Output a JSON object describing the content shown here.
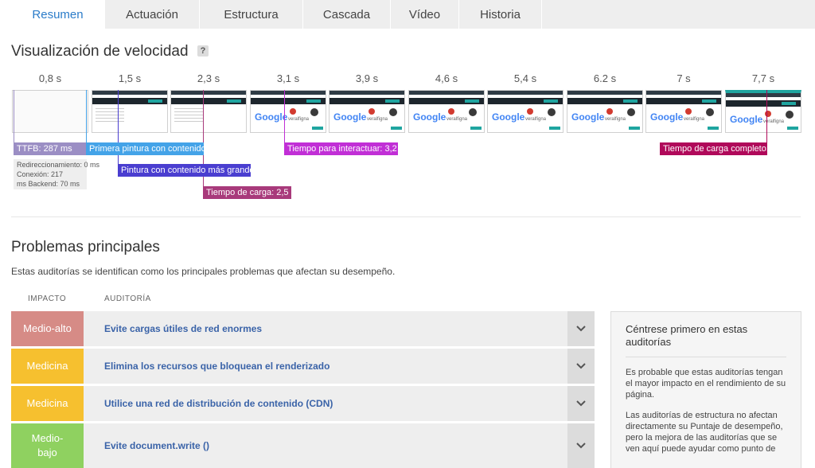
{
  "tabs": [
    "Resumen",
    "Actuación",
    "Estructura",
    "Cascada",
    "Vídeo",
    "Historia"
  ],
  "speed": {
    "title": "Visualización de velocidad",
    "help": "?",
    "times": [
      "0,8 s",
      "1,5 s",
      "2,3 s",
      "3,1 s",
      "3,9 s",
      "4,6 s",
      "5,4 s",
      "6.2 s",
      "7 s",
      "7,7 s"
    ],
    "frame_text": {
      "google": "Google",
      "web": "veralfigna",
      "sub": "Tipo de Campo"
    },
    "markers": {
      "ttfb": "TTFB: 287 ms",
      "first_paint": "Primera pintura con contenido: 1,5 s",
      "largest_paint": "Pintura con contenido más grande: 1,9 s",
      "load_time": "Tiempo de carga: 2,5 s",
      "interactive": "Tiempo para interactuar: 3,2 s",
      "fully_loaded": "Tiempo de carga completo: 7,9 s",
      "colors": {
        "ttfb": "#9b8ec4",
        "first_paint": "#44a3e8",
        "largest_paint": "#4a3ed0",
        "load_time": "#a83a7b",
        "interactive": "#c12fd6",
        "fully_loaded": "#b0095a"
      }
    },
    "ttfb_details": [
      "Redireccionamiento: 0 ms",
      "Conexión: 217",
      "ms Backend: 70 ms"
    ]
  },
  "problems": {
    "title": "Problemas principales",
    "description": "Estas auditorías se identifican como los principales problemas que afectan su desempeño.",
    "col_impact": "IMPACTO",
    "col_audit": "AUDITORÍA",
    "rows": [
      {
        "impact": "Medio-alto",
        "audit": "Evite cargas útiles de red enormes",
        "color": "#d68b86"
      },
      {
        "impact": "Medicina",
        "audit": "Elimina los recursos que bloquean el renderizado",
        "color": "#f6c02f"
      },
      {
        "impact": "Medicina",
        "audit": "Utilice una red de distribución de contenido (CDN)",
        "color": "#f6c02f"
      },
      {
        "impact": "Medio-bajo",
        "audit": "Evite document.write ()",
        "color": "#8fd160"
      }
    ]
  },
  "sidebar": {
    "title": "Céntrese primero en estas auditorías",
    "p1": "Es probable que estas auditorías tengan el mayor impacto en el rendimiento de su página.",
    "p2": "Las auditorías de estructura no afectan directamente su Puntaje de desempeño, pero la mejora de las auditorías que se ven aquí puede ayudar como punto de"
  }
}
